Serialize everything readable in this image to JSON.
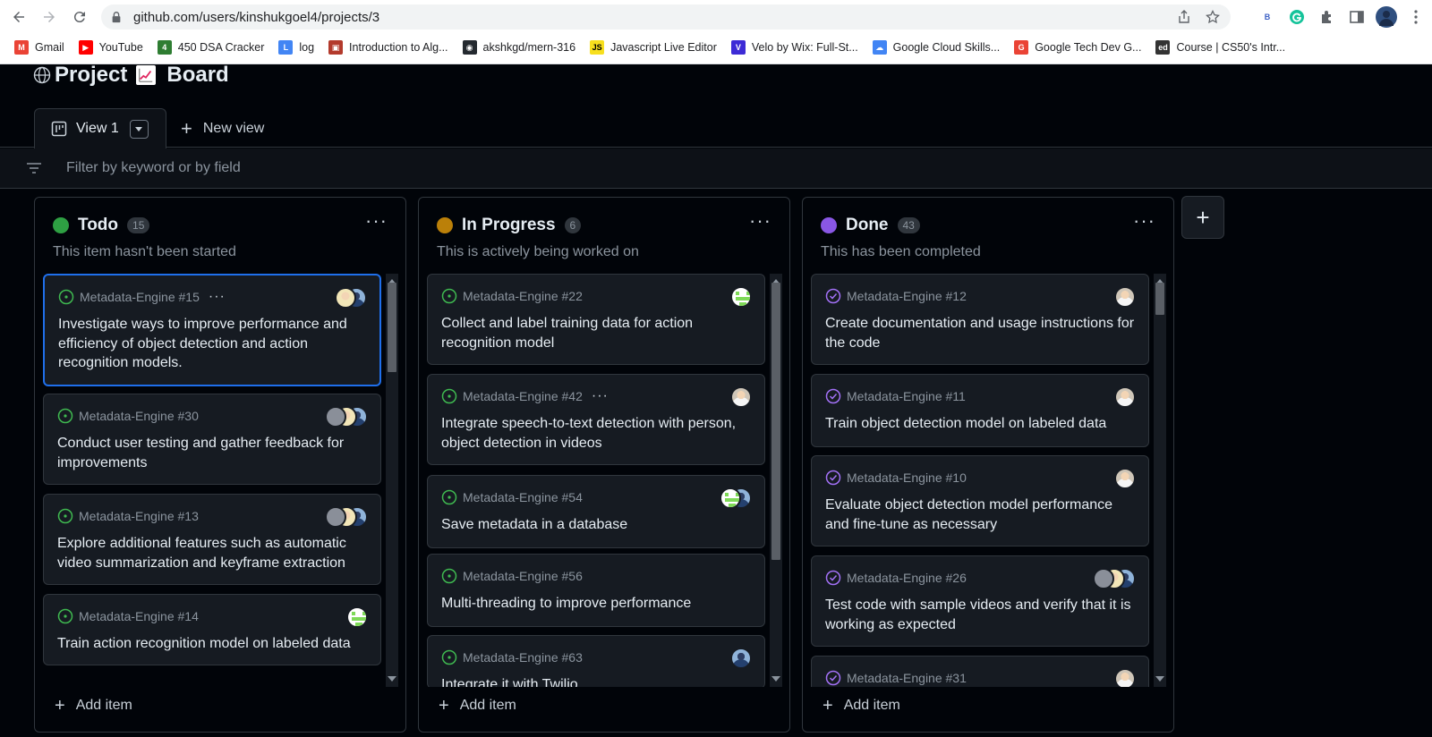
{
  "browser": {
    "url": "github.com/users/kinshukgoel4/projects/3",
    "ext_b": "B",
    "bookmarks": [
      {
        "label": "Gmail",
        "icon": "gmail-icon",
        "color": "#ea4335",
        "glyph": "M"
      },
      {
        "label": "YouTube",
        "icon": "youtube-icon",
        "color": "#ff0000",
        "glyph": "▶"
      },
      {
        "label": "450 DSA Cracker",
        "icon": "dsa-icon",
        "color": "#2e7d32",
        "glyph": "4"
      },
      {
        "label": "log",
        "icon": "log-icon",
        "color": "#4285f4",
        "glyph": "L"
      },
      {
        "label": "Introduction to Alg...",
        "icon": "book-icon",
        "color": "#b33a2c",
        "glyph": "▣"
      },
      {
        "label": "akshkgd/mern-316",
        "icon": "github-icon",
        "color": "#24292f",
        "glyph": "◉"
      },
      {
        "label": "Javascript Live Editor",
        "icon": "js-icon",
        "color": "#f7df1e",
        "glyph": "JS"
      },
      {
        "label": "Velo by Wix: Full-St...",
        "icon": "velo-icon",
        "color": "#3d2bd6",
        "glyph": "V"
      },
      {
        "label": "Google Cloud Skills...",
        "icon": "google-cloud-icon",
        "color": "#4285f4",
        "glyph": "☁"
      },
      {
        "label": "Google Tech Dev G...",
        "icon": "google-icon",
        "color": "#ea4335",
        "glyph": "G"
      },
      {
        "label": "Course | CS50's Intr...",
        "icon": "cs50-icon",
        "color": "#333333",
        "glyph": "ed"
      }
    ]
  },
  "project": {
    "title_part1": "Project",
    "title_part2": "Board",
    "emoji_icon": "chart-increasing-icon"
  },
  "views": {
    "active": "View 1",
    "new_view": "New view"
  },
  "filter": {
    "placeholder": "Filter by keyword or by field"
  },
  "columns": [
    {
      "title": "Todo",
      "count": "15",
      "color": "#2ea043",
      "description": "This item hasn't been started",
      "add_item": "Add item",
      "cards": [
        {
          "ref": "Metadata-Engine #15",
          "text": "Investigate ways to improve performance and efficiency of object detection and action recognition models.",
          "avatars": [
            "blue",
            "yellow"
          ],
          "selected": true,
          "dots": true
        },
        {
          "ref": "Metadata-Engine #30",
          "text": "Conduct user testing and gather feedback for improvements",
          "avatars": [
            "blue",
            "yellow",
            "gray"
          ],
          "selected": false,
          "dots": false
        },
        {
          "ref": "Metadata-Engine #13",
          "text": "Explore additional features such as automatic video summarization and keyframe extraction",
          "avatars": [
            "blue",
            "yellow",
            "gray"
          ],
          "selected": false,
          "dots": false
        },
        {
          "ref": "Metadata-Engine #14",
          "text": "Train action recognition model on labeled data",
          "avatars": [
            "green"
          ],
          "selected": false,
          "dots": false
        }
      ]
    },
    {
      "title": "In Progress",
      "count": "6",
      "color": "#bb8009",
      "description": "This is actively being worked on",
      "add_item": "Add item",
      "cards": [
        {
          "ref": "Metadata-Engine #22",
          "text": "Collect and label training data for action recognition model",
          "avatars": [
            "green"
          ],
          "selected": false,
          "dots": false
        },
        {
          "ref": "Metadata-Engine #42",
          "text": "Integrate speech-to-text detection with person, object detection in videos",
          "avatars": [
            "person"
          ],
          "selected": false,
          "dots": true
        },
        {
          "ref": "Metadata-Engine #54",
          "text": "Save metadata in a database",
          "avatars": [
            "blue",
            "green"
          ],
          "selected": false,
          "dots": false
        },
        {
          "ref": "Metadata-Engine #56",
          "text": "Multi-threading to improve performance",
          "avatars": [],
          "selected": false,
          "dots": false
        },
        {
          "ref": "Metadata-Engine #63",
          "text": "Integrate it with Twilio",
          "avatars": [
            "blue"
          ],
          "selected": false,
          "dots": false
        }
      ]
    },
    {
      "title": "Done",
      "count": "43",
      "color": "#8957e5",
      "description": "This has been completed",
      "add_item": "Add item",
      "cards": [
        {
          "ref": "Metadata-Engine #12",
          "text": "Create documentation and usage instructions for the code",
          "avatars": [
            "person"
          ],
          "selected": false,
          "dots": false
        },
        {
          "ref": "Metadata-Engine #11",
          "text": "Train object detection model on labeled data",
          "avatars": [
            "person"
          ],
          "selected": false,
          "dots": false
        },
        {
          "ref": "Metadata-Engine #10",
          "text": "Evaluate object detection model performance and fine-tune as necessary",
          "avatars": [
            "person"
          ],
          "selected": false,
          "dots": false
        },
        {
          "ref": "Metadata-Engine #26",
          "text": "Test code with sample videos and verify that it is working as expected",
          "avatars": [
            "blue",
            "yellow",
            "gray"
          ],
          "selected": false,
          "dots": false
        },
        {
          "ref": "Metadata-Engine #31",
          "text": "",
          "avatars": [
            "person"
          ],
          "selected": false,
          "dots": false
        }
      ]
    }
  ]
}
